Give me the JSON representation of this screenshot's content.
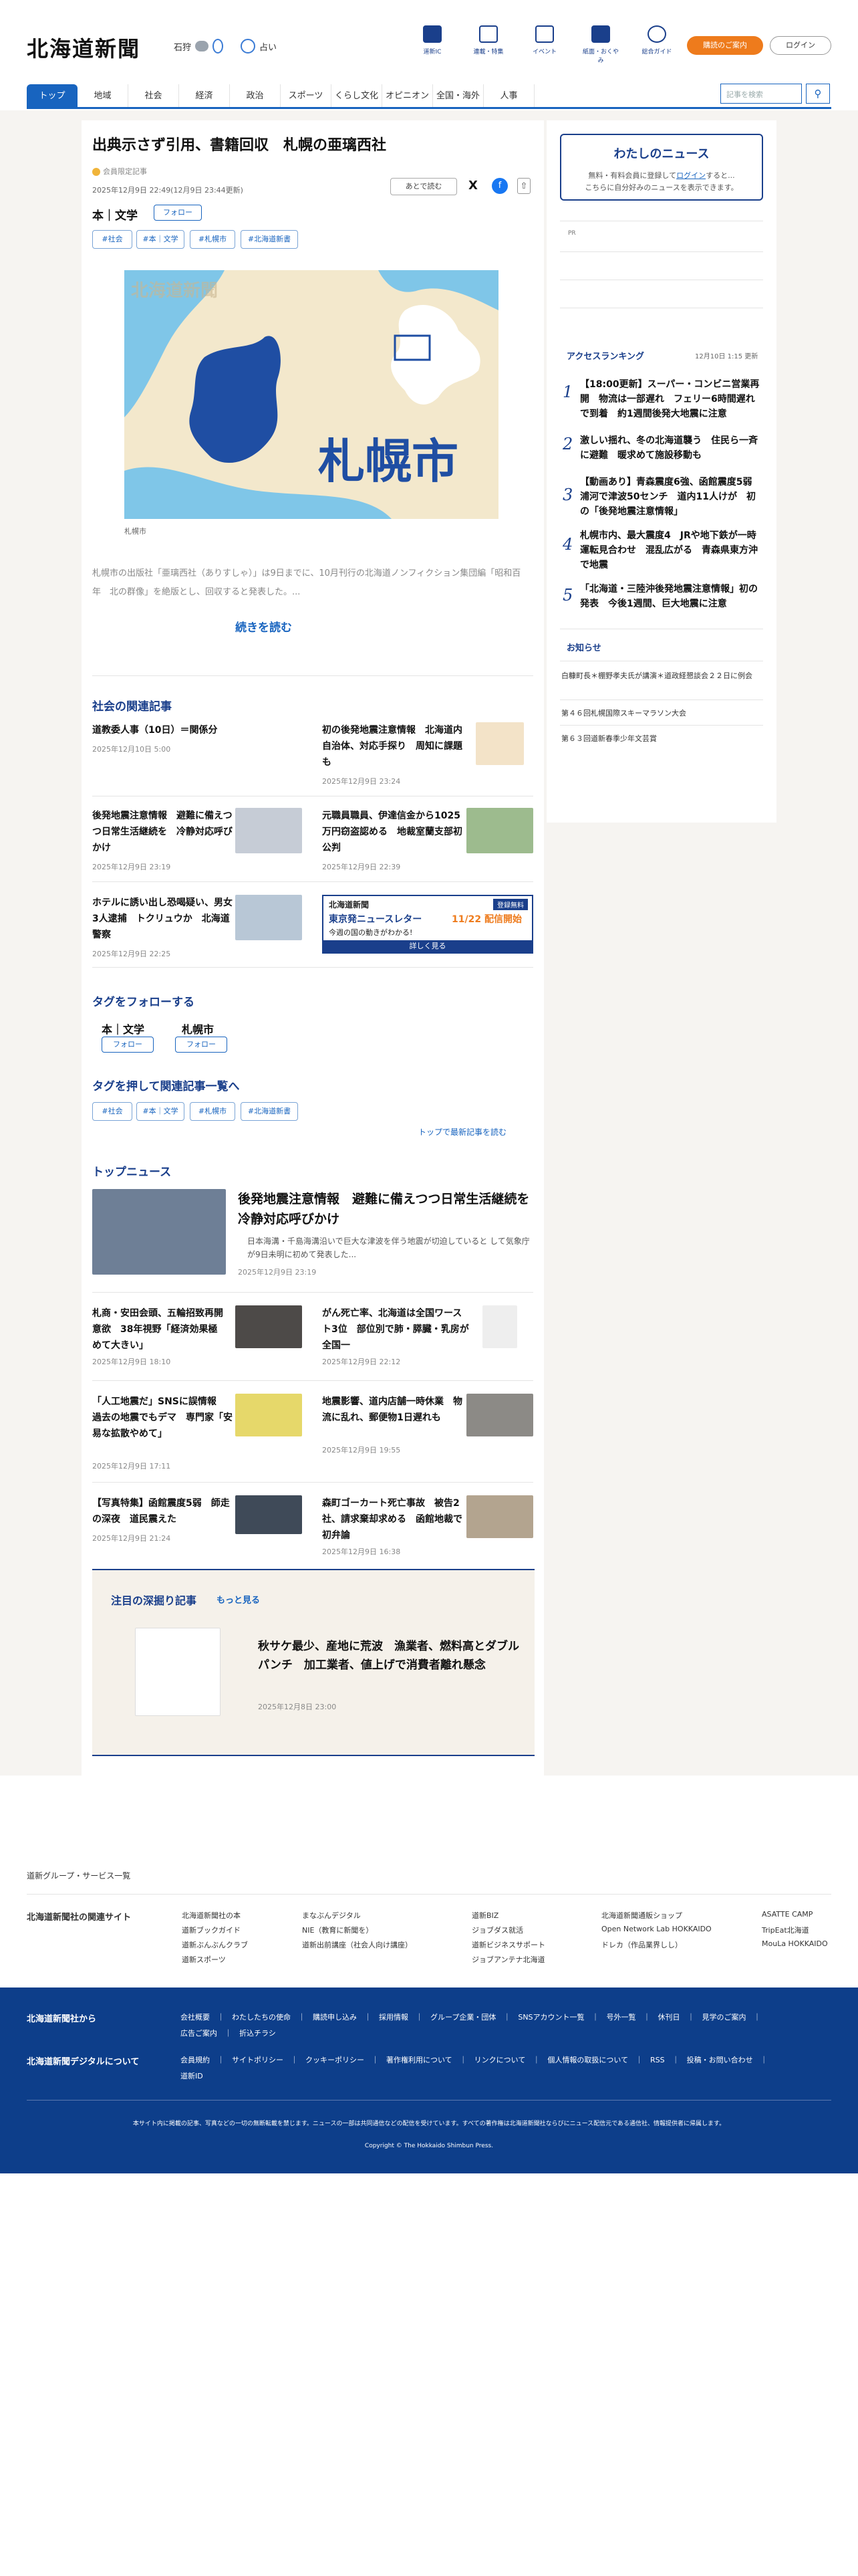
{
  "header": {
    "logo": "北海道新聞",
    "weather_place": "石狩",
    "weather_label": "占い",
    "tools": [
      "道新IC",
      "連載・特集",
      "イベント",
      "紙面・おくやみ",
      "総合ガイド"
    ],
    "buy_label": "購読のご案内",
    "login_label": "ログイン"
  },
  "nav": {
    "items": [
      "トップ",
      "地域",
      "社会",
      "経済",
      "政治",
      "スポーツ",
      "くらし文化",
      "オピニオン",
      "全国・海外",
      "人事"
    ],
    "search_placeholder": "記事を検索",
    "search_icon": "⚲"
  },
  "article": {
    "title": "出典示さず引用、書籍回収　札幌の亜璃西社",
    "member_label": "会員限定記事",
    "date": "2025年12月9日 22:49(12月9日 23:44更新)",
    "save_label": "あとで読む",
    "share_x": "X",
    "share_fb": "f",
    "share_up": "⇧",
    "topic": "本｜文学",
    "follow_label": "フォロー",
    "tags": [
      "#社会",
      "#本｜文学",
      "#札幌市",
      "#北海道新書"
    ],
    "map_logo": "北海道新聞",
    "map_city": "札幌市",
    "map_caption": "札幌市",
    "lead": "札幌市の出版社「亜璃西社（ありすしゃ）」は9日までに、10月刊行の北海道ノンフィクション集団編「昭和百年　北の群像」を絶版とし、回収すると発表した。...",
    "read_more": "続きを読む"
  },
  "related": {
    "heading": "社会の関連記事",
    "items": [
      {
        "title": "道教委人事（10日）＝関係分",
        "date": "2025年12月10日 5:00"
      },
      {
        "title": "初の後発地震注意情報　北海道内自治体、対応手探り　周知に課題も",
        "date": "2025年12月9日 23:24"
      },
      {
        "title": "後発地震注意情報　避難に備えつつ日常生活継続を　冷静対応呼びかけ",
        "date": "2025年12月9日 23:19"
      },
      {
        "title": "元職員職員、伊達信金から1025万円窃盗認める　地裁室蘭支部初公判",
        "date": "2025年12月9日 22:39"
      },
      {
        "title": "ホテルに誘い出し恐喝疑い、男女3人逮捕　トクリュウか　北海道警察",
        "date": "2025年12月9日 22:25"
      }
    ],
    "ad": {
      "logo": "北海道新聞",
      "badge": "登録無料",
      "name": "東京発ニュースレター",
      "date": "11/22 配信開始",
      "sub": "今週の国の動きがわかる!",
      "cta": "詳しく見る"
    }
  },
  "follow_tags": {
    "heading": "タグをフォローする",
    "items": [
      "本｜文学",
      "札幌市"
    ],
    "follow_label": "フォロー"
  },
  "tag_links": {
    "heading": "タグを押して関連記事一覧へ",
    "tags": [
      "#社会",
      "#本｜文学",
      "#札幌市",
      "#北海道新書"
    ],
    "more": "トップで最新記事を読む"
  },
  "top_news": {
    "heading": "トップニュース",
    "lead_title": "後発地震注意情報　避難に備えつつ日常生活継続を　冷静対応呼びかけ",
    "lead_text": "日本海溝・千島海溝沿いで巨大な津波を伴う地震が切迫していると して気象庁が9日未明に初めて発表した...",
    "lead_date": "2025年12月9日 23:19",
    "items": [
      {
        "title": "札商・安田会頭、五輪招致再開意欲　38年視野「経済効果極めて大きい」",
        "date": "2025年12月9日 18:10"
      },
      {
        "title": "がん死亡率、北海道は全国ワースト3位　部位別で肺・膵臓・乳房が全国一",
        "date": "2025年12月9日 22:12"
      },
      {
        "title": "「人工地震だ」SNSに誤情報　過去の地震でもデマ　専門家「安易な拡散やめて」",
        "date": "2025年12月9日 17:11"
      },
      {
        "title": "地震影響、道内店舗一時休業　物流に乱れ、郵便物1日遅れも",
        "date": "2025年12月9日 19:55"
      },
      {
        "title": "【写真特集】函館震度5弱　師走の深夜　道民震えた",
        "date": "2025年12月9日 21:24"
      },
      {
        "title": "森町ゴーカート死亡事故　被告2社、請求棄却求める　函館地裁で初弁論",
        "date": "2025年12月9日 16:38"
      }
    ]
  },
  "feature": {
    "heading": "注目の深掘り記事",
    "more": "もっと見る",
    "title": "秋サケ最少、産地に荒波　漁業者、燃料高とダブルパンチ　加工業者、値上げで消費者離れ懸念",
    "date": "2025年12月8日 23:00"
  },
  "sidebar": {
    "mynews_title": "わたしのニュース",
    "mynews_text1": "無料・有料会員に登録して",
    "mynews_login": "ログイン",
    "mynews_text2": "すると...",
    "mynews_text3": "こちらに自分好みのニュースを表示できます。",
    "pr_label": "PR",
    "ranking_heading": "アクセスランキング",
    "ranking_time": "12月10日 1:15 更新",
    "ranking": [
      "【18:00更新】スーパー・コンビニ営業再開　物流は一部遅れ　フェリー6時間遅れで到着　約1週間後発大地震に注意",
      "激しい揺れ、冬の北海道襲う　住民ら一斉に避難　暖求めて施設移動も",
      "【動画あり】青森震度6強、函館震度5弱　浦河で津波50センチ　道内11人けが　初の「後発地震注意情報」",
      "札幌市内、最大震度4　JRや地下鉄が一時運転見合わせ　混乱広がる　青森県東方沖で地震",
      "「北海道・三陸沖後発地震注意情報」初の発表　今後1週間、巨大地震に注意"
    ],
    "notice_heading": "お知らせ",
    "notices": [
      "白糠町長＊棚野孝夫氏が講演＊道政経懇談会２２日に例会",
      "第４６回札幌国際スキーマラソン大会",
      "第６３回道新春季少年文芸賞"
    ]
  },
  "footer": {
    "group_label": "道新グループ・サービス一覧",
    "related_label": "北海道新聞社の関連サイト",
    "related_sites": [
      "北海道新聞社の本",
      "まなぶんデジタル",
      "道新BIZ",
      "北海道新聞通販ショップ",
      "ASATTE CAMP",
      "道新ブックガイド",
      "NIE（教育に新聞を）",
      "ジョブダス就活",
      "Open Network Lab HOKKAIDO",
      "TripEat北海道",
      "道新ぶんぶんクラブ",
      "道新出前講座（社会人向け講座）",
      "道新ビジネスサポート",
      "ドレカ（作品業界しし）",
      "MouLa HOKKAIDO",
      "道新スポーツ",
      "",
      "ジョブアンテナ北海道",
      "",
      ""
    ],
    "company_heading": "北海道新聞社から",
    "company_links": "会社概要　｜　わたしたちの使命　｜　購読申し込み　｜　採用情報　｜　グループ企業・団体　｜　SNSアカウント一覧　｜　号外一覧　｜　休刊日　｜　見学のご案内　｜",
    "company_links2": "広告ご案内　｜　折込チラシ",
    "digital_heading": "北海道新聞デジタルについて",
    "digital_links": "会員規約　｜　サイトポリシー　｜　クッキーポリシー　｜　著作権利用について　｜　リンクについて　｜　個人情報の取扱について　｜　RSS　｜　投稿・お問い合わせ　｜",
    "digital_links2": "道新ID",
    "notice": "本サイト内に掲載の記事、写真などの一切の無断転載を禁じます。ニュースの一部は共同通信などの配信を受けています。すべての著作権は北海道新聞社ならびにニュース配信元である通信社、情報提供者に帰属します。",
    "copyright": "Copyright © The Hokkaido Shimbun Press."
  }
}
